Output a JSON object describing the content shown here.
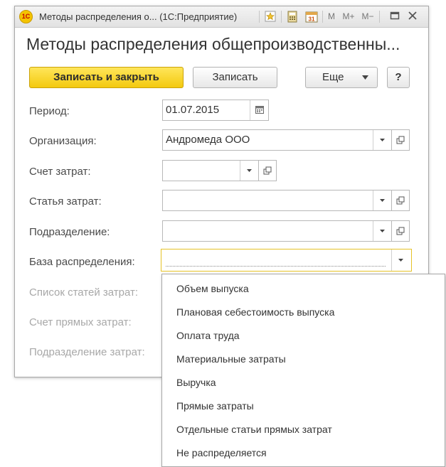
{
  "window": {
    "title": "Методы распределения о... (1С:Предприятие)",
    "logo_text": "1С",
    "toolbar_icons": [
      "favorites-star-icon",
      "calculator-icon",
      "calendar-icon",
      "m-icon",
      "m-plus-icon",
      "m-minus-icon",
      "maximize-icon",
      "close-icon"
    ],
    "toolbar_text": {
      "m": "M",
      "m_plus": "M+",
      "m_minus": "M−",
      "calendar_day": "31"
    }
  },
  "form": {
    "heading": "Методы распределения общепроизводственны..."
  },
  "buttons": {
    "save_close": "Записать и закрыть",
    "save": "Записать",
    "more": "Еще",
    "help": "?"
  },
  "fields": {
    "period": {
      "label": "Период:",
      "value": "01.07.2015"
    },
    "organization": {
      "label": "Организация:",
      "value": "Андромеда ООО"
    },
    "cost_account": {
      "label": "Счет затрат:",
      "value": ""
    },
    "cost_item": {
      "label": "Статья затрат:",
      "value": ""
    },
    "department": {
      "label": "Подразделение:",
      "value": ""
    },
    "allocation_base": {
      "label": "База распределения:",
      "value": ""
    },
    "cost_items_list": {
      "label": "Список статей затрат:"
    },
    "direct_cost_account": {
      "label": "Счет прямых затрат:"
    },
    "cost_department": {
      "label": "Подразделение затрат:"
    }
  },
  "dropdown": {
    "options": [
      "Объем выпуска",
      "Плановая себестоимость выпуска",
      "Оплата труда",
      "Материальные затраты",
      "Выручка",
      "Прямые затраты",
      "Отдельные статьи прямых затрат",
      "Не распределяется"
    ]
  },
  "colors": {
    "primary_button": "#f3c90f",
    "focus_border": "#e6c227",
    "logo": "#f4c400"
  }
}
